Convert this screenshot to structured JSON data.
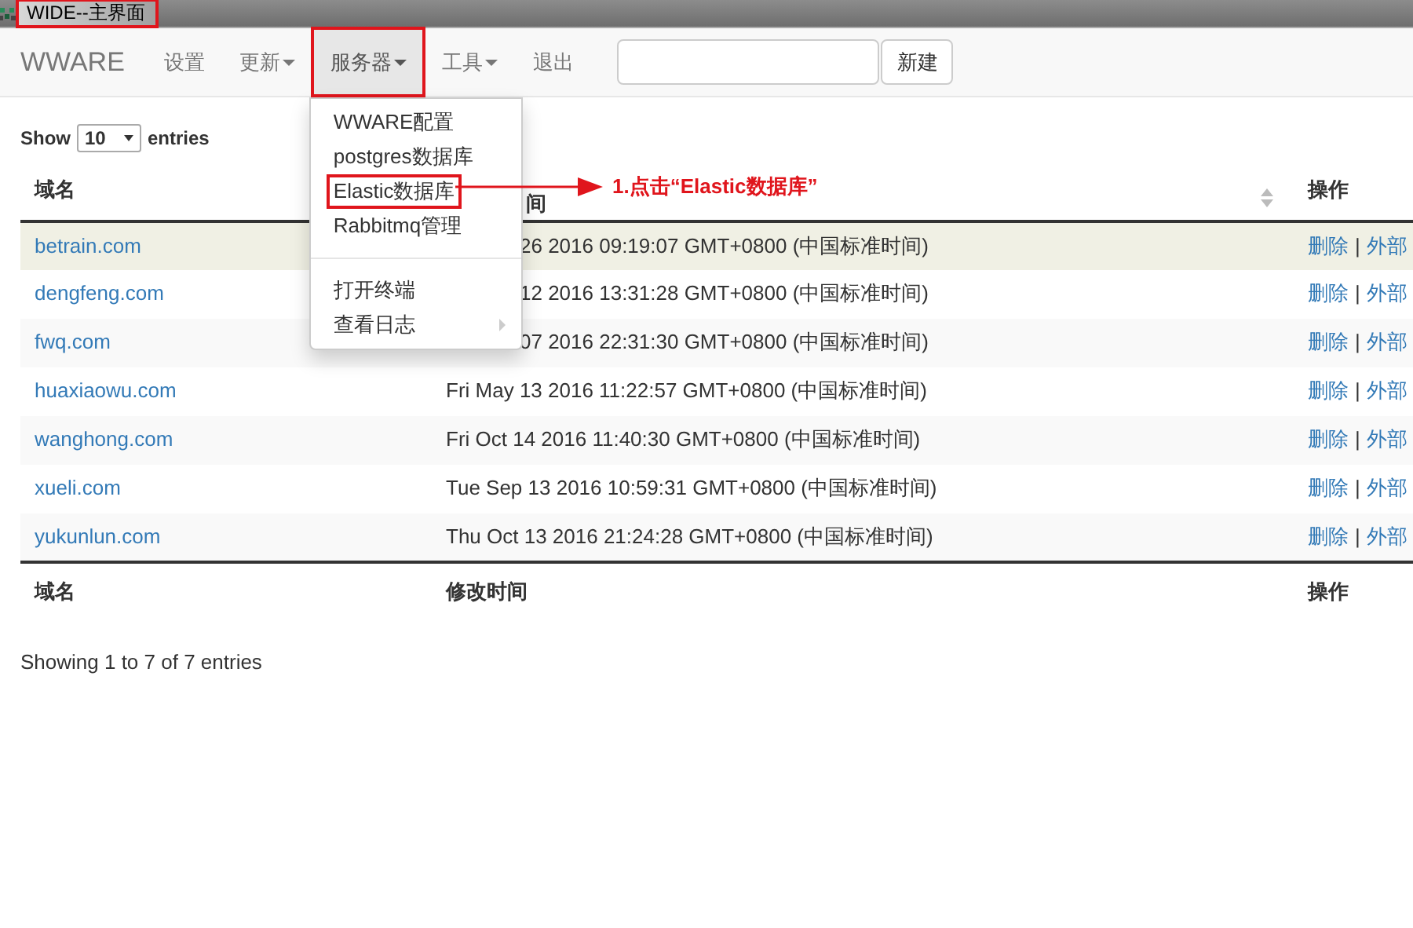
{
  "window": {
    "title": "WIDE--主界面",
    "highlighted": true
  },
  "navbar": {
    "brand": "WWARE",
    "items": [
      {
        "label": "设置",
        "dropdown": false,
        "selected": false,
        "highlighted": false
      },
      {
        "label": "更新",
        "dropdown": true,
        "selected": false,
        "highlighted": false
      },
      {
        "label": "服务器",
        "dropdown": true,
        "selected": true,
        "highlighted": true
      },
      {
        "label": "工具",
        "dropdown": true,
        "selected": false,
        "highlighted": false
      },
      {
        "label": "退出",
        "dropdown": false,
        "selected": false,
        "highlighted": false
      }
    ],
    "button": "新建"
  },
  "dropdown_menu": {
    "items": [
      {
        "kind": "item",
        "label": "WWARE配置",
        "highlighted": false,
        "submenu": false
      },
      {
        "kind": "item",
        "label": "postgres数据库",
        "highlighted": false,
        "submenu": false
      },
      {
        "kind": "item",
        "label": "Elastic数据库",
        "highlighted": true,
        "submenu": false
      },
      {
        "kind": "item",
        "label": "Rabbitmq管理",
        "highlighted": false,
        "submenu": false
      },
      {
        "kind": "divider"
      },
      {
        "kind": "item",
        "label": "打开终端",
        "highlighted": false,
        "submenu": false
      },
      {
        "kind": "item",
        "label": "查看日志",
        "highlighted": false,
        "submenu": true
      }
    ]
  },
  "annotation": {
    "text": "1.点击“Elastic数据库”"
  },
  "length_menu": {
    "prefix": "Show",
    "value": "10",
    "suffix": "entries"
  },
  "table": {
    "columns": [
      {
        "label": "域名",
        "partly_hidden": false
      },
      {
        "label": "间",
        "sortable": true,
        "partly_hidden": true
      },
      {
        "label": "操作",
        "partly_hidden": false
      }
    ],
    "rows": [
      {
        "domain": "betrain.com",
        "modified": "26 2016 09:19:07 GMT+0800 (中国标准时间)",
        "partly_hidden": true,
        "selected": true,
        "actions": [
          "删除",
          "外部"
        ],
        "separator": "|"
      },
      {
        "domain": "dengfeng.com",
        "modified": "12 2016 13:31:28 GMT+0800 (中国标准时间)",
        "partly_hidden": true,
        "selected": false,
        "actions": [
          "删除",
          "外部"
        ],
        "separator": "|"
      },
      {
        "domain": "fwq.com",
        "modified": "07 2016 22:31:30 GMT+0800 (中国标准时间)",
        "partly_hidden": true,
        "selected": false,
        "actions": [
          "删除",
          "外部"
        ],
        "separator": "|"
      },
      {
        "domain": "huaxiaowu.com",
        "modified": "Fri May 13 2016 11:22:57 GMT+0800 (中国标准时间)",
        "partly_hidden": false,
        "selected": false,
        "actions": [
          "删除",
          "外部"
        ],
        "separator": "|"
      },
      {
        "domain": "wanghong.com",
        "modified": "Fri Oct 14 2016 11:40:30 GMT+0800 (中国标准时间)",
        "partly_hidden": false,
        "selected": false,
        "actions": [
          "删除",
          "外部"
        ],
        "separator": "|"
      },
      {
        "domain": "xueli.com",
        "modified": "Tue Sep 13 2016 10:59:31 GMT+0800 (中国标准时间)",
        "partly_hidden": false,
        "selected": false,
        "actions": [
          "删除",
          "外部"
        ],
        "separator": "|"
      },
      {
        "domain": "yukunlun.com",
        "modified": "Thu Oct 13 2016 21:24:28 GMT+0800 (中国标准时间)",
        "partly_hidden": false,
        "selected": false,
        "actions": [
          "删除",
          "外部"
        ],
        "separator": "|"
      }
    ],
    "footer_columns": [
      "域名",
      "修改时间",
      "操作"
    ]
  },
  "info": "Showing 1 to 7 of 7 entries"
}
